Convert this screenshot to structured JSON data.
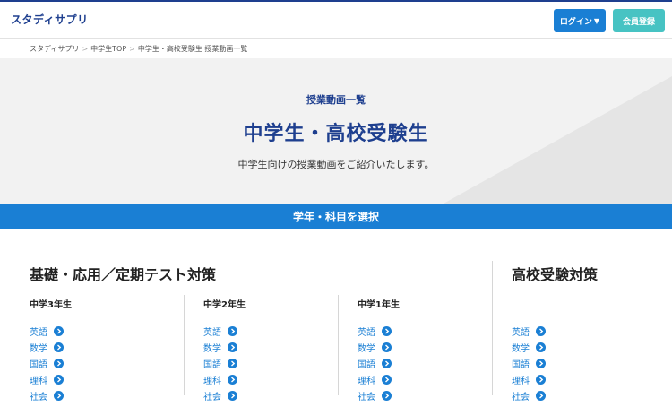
{
  "header": {
    "logo": "スタディサプリ",
    "login_label": "ログイン",
    "register_label": "会員登録"
  },
  "breadcrumb": [
    "スタディサプリ",
    "中学生TOP",
    "中学生・高校受験生 授業動画一覧"
  ],
  "hero": {
    "subtitle": "授業動画一覧",
    "title": "中学生・高校受験生",
    "description": "中学生向けの授業動画をご紹介いたします。"
  },
  "select_bar": "学年・科目を選択",
  "basic": {
    "title": "基礎・応用／定期テスト対策",
    "columns": [
      {
        "title": "中学3年生",
        "items": [
          "英語",
          "数学",
          "国語",
          "理科",
          "社会"
        ]
      },
      {
        "title": "中学2年生",
        "items": [
          "英語",
          "数学",
          "国語",
          "理科",
          "社会"
        ]
      },
      {
        "title": "中学1年生",
        "items": [
          "英語",
          "数学",
          "国語",
          "理科",
          "社会"
        ]
      }
    ]
  },
  "exam": {
    "title": "高校受験対策",
    "items": [
      "英語",
      "数学",
      "国語",
      "理科",
      "社会"
    ]
  },
  "colors": {
    "brand_navy": "#1e3f8f",
    "accent_blue": "#1a7fd4",
    "register_teal": "#47c3c3"
  }
}
